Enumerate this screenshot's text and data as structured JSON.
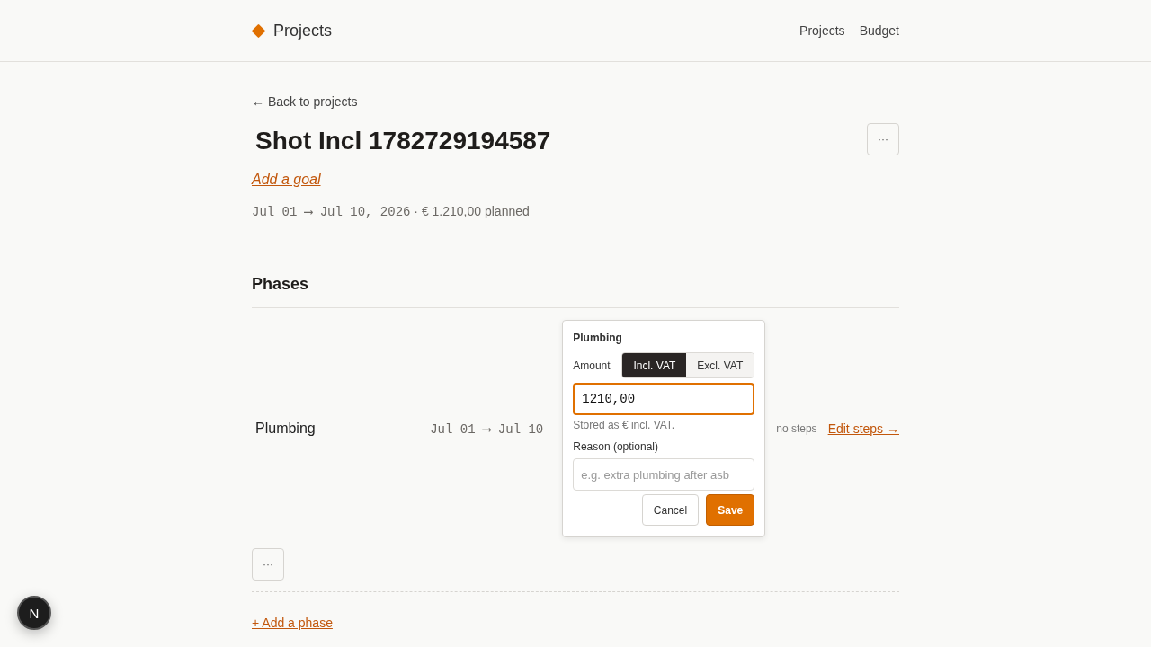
{
  "header": {
    "brand": "Projects",
    "nav": [
      {
        "label": "Projects"
      },
      {
        "label": "Budget"
      }
    ]
  },
  "back_link": "← Back to projects",
  "project": {
    "title": "Shot Incl 1782729194587",
    "more_button": "···",
    "goal_link": "Add a goal",
    "dates": "Jul 01 ⟶ Jul 10, 2026",
    "summary": "· € 1.210,00 planned"
  },
  "phases": {
    "heading": "Phases",
    "rows": [
      {
        "name": "Plumbing",
        "dates": "Jul 01 ⟶ Jul 10",
        "budget_editor": {
          "title": "Plumbing",
          "amount_label": "Amount",
          "vat_modes": [
            {
              "label": "Incl. VAT",
              "selected": true
            },
            {
              "label": "Excl. VAT",
              "selected": false
            }
          ],
          "amount_value": "1210,00",
          "amount_focused": true,
          "hint": "Stored as € incl. VAT.",
          "reason_label": "Reason (optional)",
          "reason_placeholder": "e.g. extra plumbing after asb",
          "buttons": [
            {
              "label": "Cancel",
              "kind": "secondary"
            },
            {
              "label": "Save",
              "kind": "primary"
            }
          ]
        },
        "steps": "no steps",
        "edit_link": "Edit steps →",
        "more_button": "···"
      }
    ],
    "add_link": "+ Add a phase"
  },
  "dev_badge": "N"
}
